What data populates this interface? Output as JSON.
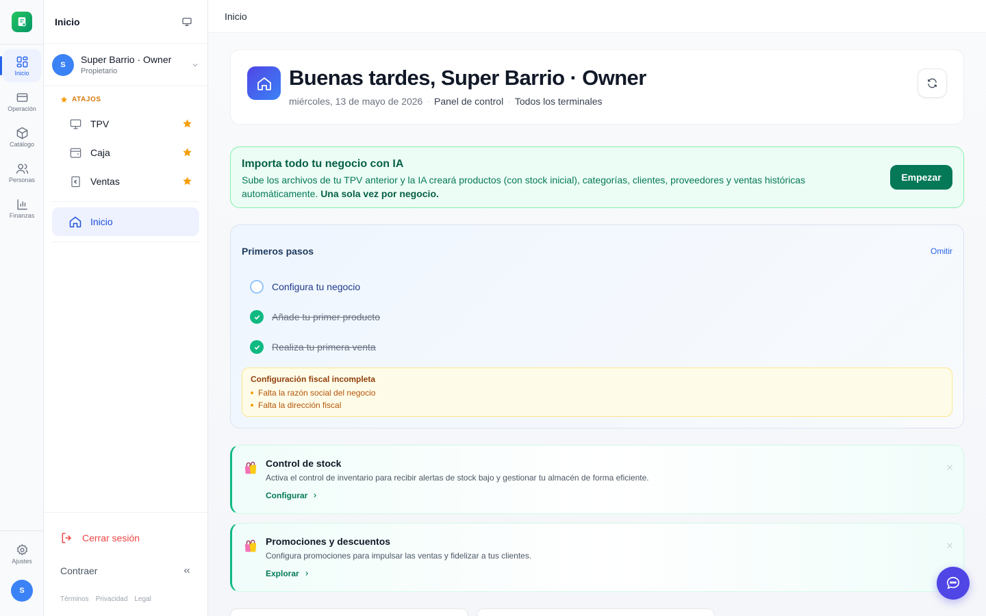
{
  "rail": {
    "items": [
      {
        "label": "Inicio",
        "icon": "dashboard-grid-icon"
      },
      {
        "label": "Operación",
        "icon": "credit-card-icon"
      },
      {
        "label": "Catálogo",
        "icon": "package-icon"
      },
      {
        "label": "Personas",
        "icon": "users-icon"
      },
      {
        "label": "Finanzas",
        "icon": "bar-chart-icon"
      }
    ],
    "settings_label": "Ajustes",
    "avatar_initial": "S"
  },
  "sidebar": {
    "title": "Inicio",
    "user": {
      "initial": "S",
      "name": "Super Barrio · Owner",
      "role": "Propietario"
    },
    "shortcuts_label": "ATAJOS",
    "shortcuts": [
      {
        "label": "TPV",
        "icon": "monitor-icon"
      },
      {
        "label": "Caja",
        "icon": "cash-drawer-icon"
      },
      {
        "label": "Ventas",
        "icon": "euro-receipt-icon"
      }
    ],
    "active_item": {
      "label": "Inicio",
      "icon": "home-icon"
    },
    "logout_label": "Cerrar sesión",
    "collapse_label": "Contraer",
    "legal": {
      "terms": "Términos",
      "privacy": "Privacidad",
      "legal": "Legal"
    }
  },
  "topbar": {
    "breadcrumb": "Inicio"
  },
  "greeting": {
    "title": "Buenas tardes, Super Barrio · Owner",
    "date": "miércoles, 13 de mayo de 2026",
    "panel": "Panel de control",
    "terminals": "Todos los terminales"
  },
  "ia_banner": {
    "title": "Importa todo tu negocio con IA",
    "description": "Sube los archivos de tu TPV anterior y la IA creará productos (con stock inicial), categorías, clientes, proveedores y ventas históricas automáticamente.",
    "description_bold": "Una sola vez por negocio.",
    "button": "Empezar"
  },
  "first_steps": {
    "title": "Primeros pasos",
    "skip": "Omitir",
    "steps": [
      {
        "label": "Configura tu negocio",
        "done": false
      },
      {
        "label": "Añade tu primer producto",
        "done": true
      },
      {
        "label": "Realiza tu primera venta",
        "done": true
      }
    ],
    "warning": {
      "title": "Configuración fiscal incompleta",
      "items": [
        "Falta la razón social del negocio",
        "Falta la dirección fiscal"
      ]
    }
  },
  "promos": [
    {
      "title": "Control de stock",
      "description": "Activa el control de inventario para recibir alertas de stock bajo y gestionar tu almacén de forma eficiente.",
      "link": "Configurar",
      "icon": "shopping-bags-icon"
    },
    {
      "title": "Promociones y descuentos",
      "description": "Configura promociones para impulsar las ventas y fidelizar a tus clientes.",
      "link": "Explorar",
      "icon": "shopping-bags-icon"
    }
  ],
  "colors": {
    "primary": "#2563eb",
    "success": "#047857",
    "danger": "#ef4444",
    "warning": "#d97706",
    "chat": "#4f46e5"
  }
}
